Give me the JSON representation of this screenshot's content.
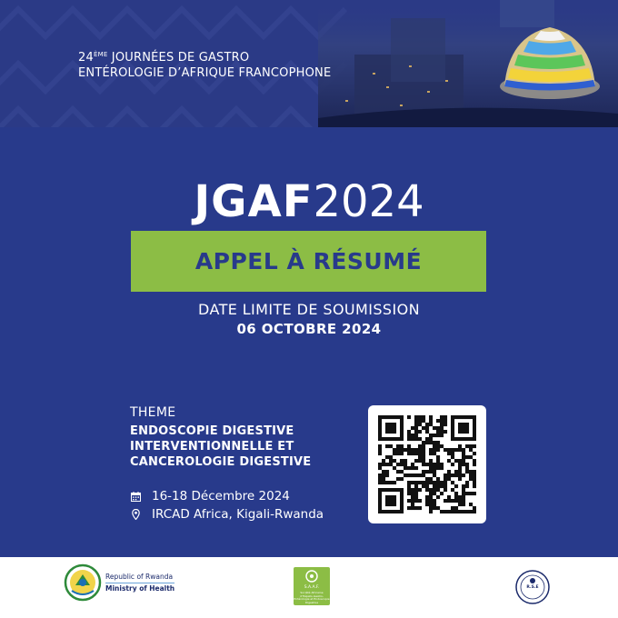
{
  "header": {
    "title_line1_prefix": "24",
    "title_line1_sup": "ÈME",
    "title_line1_rest": " JOURNÉES DE GASTRO",
    "title_line2": "ENTÉROLOGIE D’AFRIQUE FRANCOPHONE"
  },
  "event": {
    "acronym": "JGAF",
    "year": "2024",
    "call": "APPEL À RÉSUMÉ",
    "deadline_label": "DATE LIMITE DE SOUMISSION",
    "deadline_date": "06 OCTOBRE 2024"
  },
  "theme": {
    "label": "THEME",
    "line1": "ENDOSCOPIE DIGESTIVE",
    "line2": "INTERVENTIONNELLE ET",
    "line3": "CANCEROLOGIE DIGESTIVE"
  },
  "details": {
    "dates": "16-18 Décembre 2024",
    "date_icon": "calendar-icon",
    "venue": "IRCAD Africa, Kigali-Rwanda",
    "venue_icon": "location-pin-icon"
  },
  "footer": {
    "rwanda_line1": "Republic of Rwanda",
    "rwanda_line2": "Ministry of Health",
    "saaf_name": "S.A.A.F.",
    "saaf_sub": "Société Africaine d’Hépato-Gastro-Entérologie et Endoscopie Digestive",
    "rse_label": "R.S.E"
  },
  "colors": {
    "navy": "#283a8b",
    "green": "#8cbd45",
    "white": "#ffffff"
  }
}
